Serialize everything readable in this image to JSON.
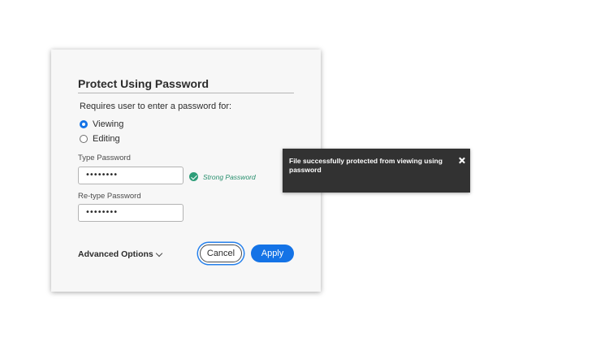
{
  "dialog": {
    "title": "Protect Using Password",
    "description": "Requires user to enter a password for:",
    "options": [
      {
        "label": "Viewing",
        "selected": true
      },
      {
        "label": "Editing",
        "selected": false
      }
    ],
    "type_password": {
      "label": "Type Password",
      "value": "••••••••"
    },
    "strength": {
      "icon": "checkmark-circle-icon",
      "text": "Strong Password",
      "color": "#2d9d78"
    },
    "retype_password": {
      "label": "Re-type Password",
      "value": "••••••••"
    },
    "advanced_label": "Advanced Options",
    "cancel_label": "Cancel",
    "apply_label": "Apply"
  },
  "toast": {
    "message": "File successfully protected from viewing using password",
    "close_icon": "close-icon"
  },
  "colors": {
    "accent": "#1473e6",
    "success": "#2d9d78",
    "toast_bg": "#323232"
  }
}
